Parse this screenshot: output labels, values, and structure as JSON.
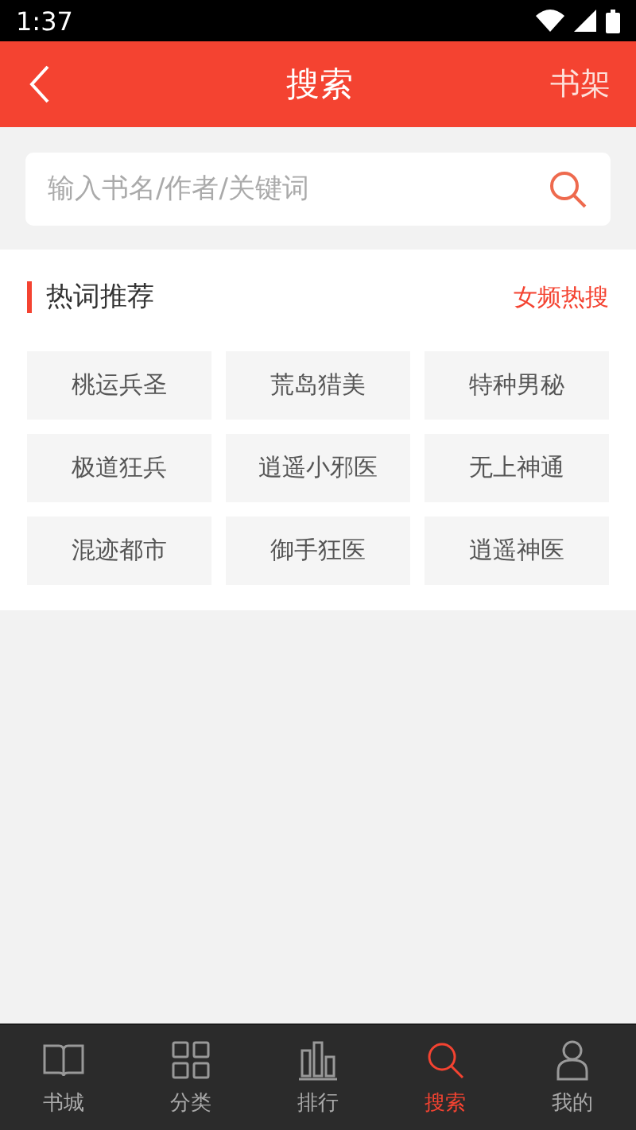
{
  "status_bar": {
    "time": "1:37"
  },
  "header": {
    "title": "搜索",
    "action": "书架"
  },
  "search": {
    "placeholder": "输入书名/作者/关键词"
  },
  "hot": {
    "title": "热词推荐",
    "link": "女频热搜",
    "keywords": [
      "桃运兵圣",
      "荒岛猎美",
      "特种男秘",
      "极道狂兵",
      "逍遥小邪医",
      "无上神通",
      "混迹都市",
      "御手狂医",
      "逍遥神医"
    ]
  },
  "tabs": [
    {
      "kind": "book",
      "label": "书城",
      "selected": false
    },
    {
      "kind": "grid",
      "label": "分类",
      "selected": false
    },
    {
      "kind": "chart",
      "label": "排行",
      "selected": false
    },
    {
      "kind": "search",
      "label": "搜索",
      "selected": true
    },
    {
      "kind": "person",
      "label": "我的",
      "selected": false
    }
  ]
}
